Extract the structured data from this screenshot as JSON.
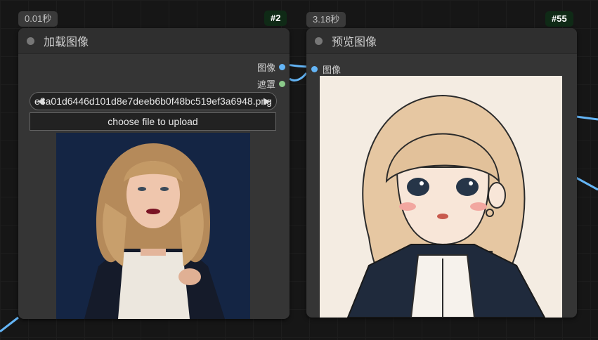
{
  "load_node": {
    "time": "0.01秒",
    "id": "#2",
    "title": "加载图像",
    "outputs": [
      {
        "label": "图像",
        "color": "#64b5f6"
      },
      {
        "label": "遮罩",
        "color": "#8bc98a"
      }
    ],
    "image_value": "e8a01d6446d101d8e7deeb6b0f48bc519ef3a6948.png",
    "upload_label": "choose file to upload",
    "preview_description": "photo of woman with wavy blonde hair"
  },
  "preview_node": {
    "time": "3.18秒",
    "id": "#55",
    "title": "预览图像",
    "input_label": "图像",
    "preview_description": "illustration of girl with blonde bob hair"
  },
  "colors": {
    "node_bg": "#353535",
    "canvas_bg": "#161616",
    "link_blue": "#64b5f6",
    "id_badge_bg": "#0f2a16"
  }
}
